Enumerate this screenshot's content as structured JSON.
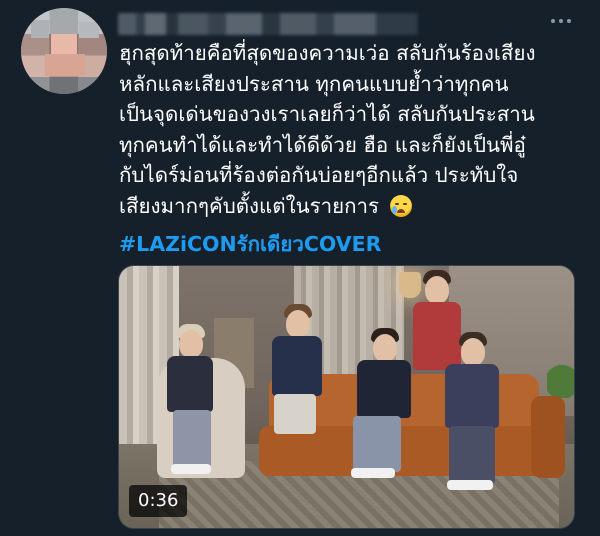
{
  "tweet": {
    "text_lines": [
      "ฮุกสุดท้ายคือที่สุดของความเว่อ สลับกันร้องเสียง",
      "หลักและเสียงประสาน ทุกคนแบบย้ำว่าทุกคน",
      "เป็นจุดเด่นของวงเราเลยก็ว่าได้ สลับกันประสาน",
      "ทุกคนทำได้และทำได้ดีด้วย ฮือ และก็ยังเป็นพี่อู๋",
      "กับไดร์ม่อนที่ร้องต่อกันบ่อยๆอีกแล้ว ประทับใจ",
      "เสียงมากๆคับตั้งแต่ในรายการ"
    ],
    "emoji": "loudly-crying-face",
    "hashtag": "#LAZiCONรักเดียวCOVER",
    "video_duration": "0:36"
  },
  "colors": {
    "background": "#15202b",
    "text": "#ffffff",
    "hashtag": "#1d9bf0",
    "muted": "#8b98a5"
  }
}
